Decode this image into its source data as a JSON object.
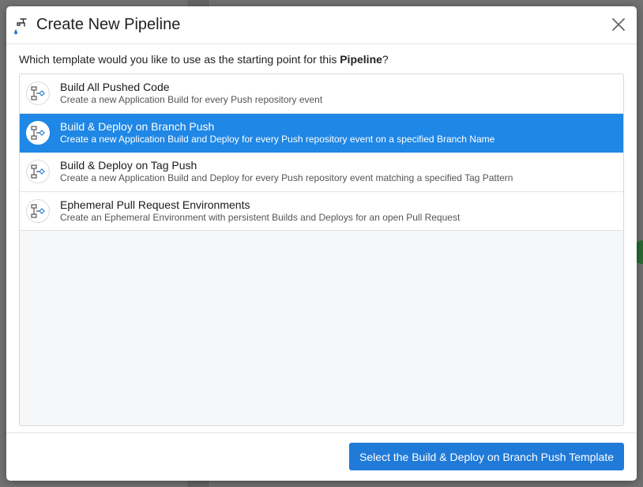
{
  "modal": {
    "title": "Create New Pipeline",
    "close_icon": "close-icon",
    "header_icon": "pipeline-faucet-icon",
    "prompt_prefix": "Which template would you like to use as the starting point for this ",
    "prompt_bold": "Pipeline",
    "prompt_suffix": "?",
    "templates": [
      {
        "title": "Build All Pushed Code",
        "description": "Create a new Application Build for every Push repository event",
        "icon": "pipeline-flow-icon",
        "selected": false
      },
      {
        "title": "Build & Deploy on Branch Push",
        "description": "Create a new Application Build and Deploy for every Push repository event on a specified Branch Name",
        "icon": "pipeline-flow-icon",
        "selected": true
      },
      {
        "title": "Build & Deploy on Tag Push",
        "description": "Create a new Application Build and Deploy for every Push repository event matching a specified Tag Pattern",
        "icon": "pipeline-flow-icon",
        "selected": false
      },
      {
        "title": "Ephemeral Pull Request Environments",
        "description": "Create an Ephemeral Environment with persistent Builds and Deploys for an open Pull Request",
        "icon": "pipeline-flow-icon",
        "selected": false
      }
    ],
    "submit_label": "Select the Build & Deploy on Branch Push Template"
  },
  "colors": {
    "selected_bg": "#1f87e5",
    "primary_button": "#1f7ad8",
    "overlay": "#6e6e6e"
  }
}
